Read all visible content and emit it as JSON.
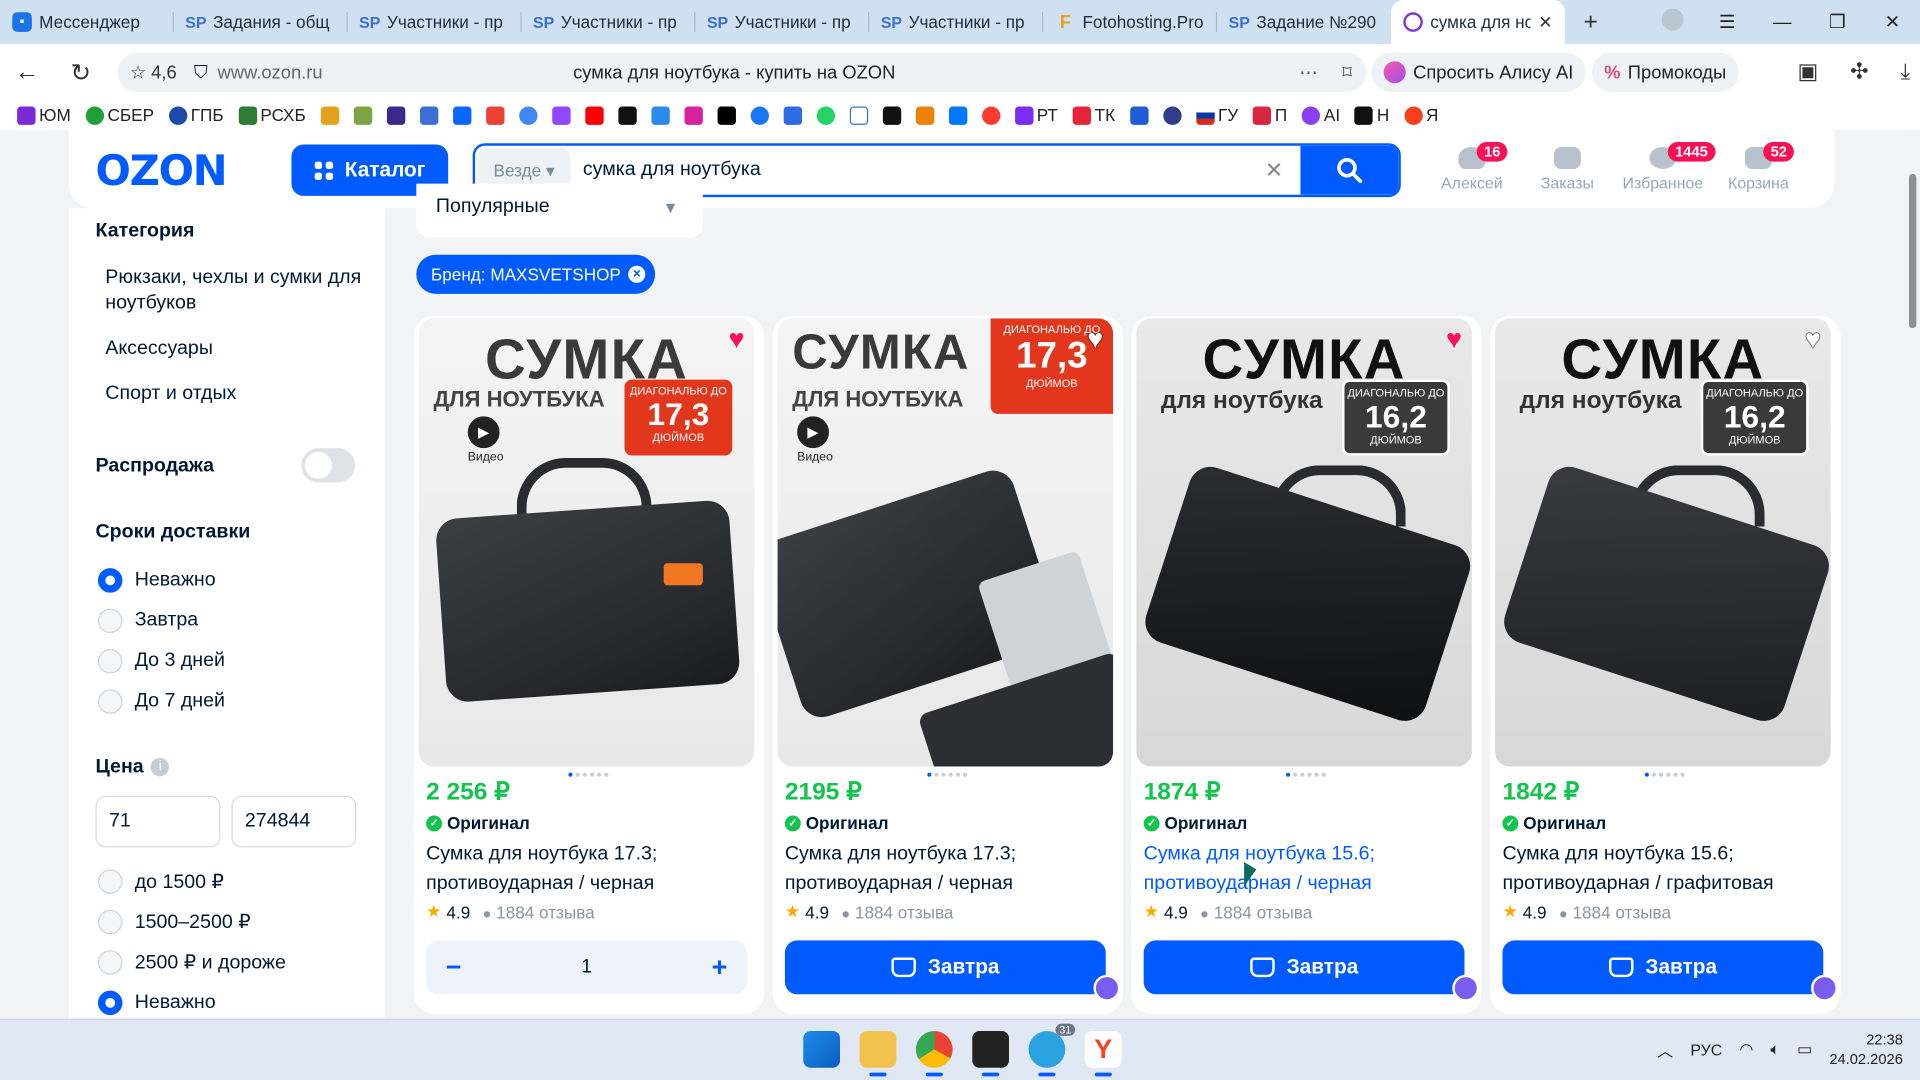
{
  "browser": {
    "tabs": [
      {
        "label": "Мессенджер",
        "icon": "messenger-icon"
      },
      {
        "label": "Задания - общ",
        "icon": "sp-icon"
      },
      {
        "label": "Участники - пр",
        "icon": "sp-icon"
      },
      {
        "label": "Участники - пр",
        "icon": "sp-icon"
      },
      {
        "label": "Участники - пр",
        "icon": "sp-icon"
      },
      {
        "label": "Участники - пр",
        "icon": "sp-icon"
      },
      {
        "label": "Fotohosting.Pro",
        "icon": "fotohosting-icon"
      },
      {
        "label": "Задание №290",
        "icon": "sp-icon"
      },
      {
        "label": "сумка для но",
        "icon": "ozon-icon",
        "active": true
      }
    ],
    "url_rating": "4,6",
    "url_host": "www.ozon.ru",
    "page_title": "сумка для ноутбука - купить на OZON",
    "alice_label": "Спросить Алису AI",
    "promo_label": "Промокоды",
    "bookmarks": [
      "ЮМ",
      "СБЕР",
      "ГПБ",
      "РСХБ",
      "РТ",
      "ТК",
      "ГУ",
      "П",
      "AI",
      "Н",
      "Я"
    ]
  },
  "header": {
    "logo": "OZON",
    "catalog_label": "Каталог",
    "search_scope": "Везде",
    "search_value": "сумка для ноутбука",
    "profile": {
      "label": "Алексей",
      "badge": "16"
    },
    "orders": {
      "label": "Заказы"
    },
    "favorites": {
      "label": "Избранное",
      "badge": "1445"
    },
    "cart": {
      "label": "Корзина",
      "badge": "52"
    }
  },
  "sidebar": {
    "category_title": "Категория",
    "categories": [
      "Рюкзаки, чехлы и сумки для ноутбуков",
      "Аксессуары",
      "Спорт и отдых"
    ],
    "sale_label": "Распродажа",
    "delivery_title": "Сроки доставки",
    "delivery_options": [
      "Неважно",
      "Завтра",
      "До 3 дней",
      "До 7 дней"
    ],
    "price_title": "Цена",
    "price_min": "71",
    "price_max": "274844",
    "price_options": [
      "до 1500 ₽",
      "1500–2500 ₽",
      "2500 ₽ и дороже",
      "Неважно"
    ]
  },
  "main": {
    "sort_value": "Популярные",
    "brand_chip": "Бренд: MAXSVETSHOP",
    "products": [
      {
        "price": "2 256 ₽",
        "badge": "Оригинал",
        "name": "Сумка для ноутбука 17.3; противоударная / черная",
        "rating": "4.9",
        "reviews": "1884 отзыва",
        "favorite": true,
        "img_title": "СУМКА",
        "img_sub": "ДЛЯ НОУТБУКА",
        "diag_top": "ДИАГОНАЛЬЮ ДО",
        "diag_value": "17,3",
        "diag_unit": "ДЮЙМОВ",
        "video": "Видео",
        "quantity": "1"
      },
      {
        "price": "2195 ₽",
        "badge": "Оригинал",
        "name": "Сумка для ноутбука 17.3; противоударная / черная",
        "rating": "4.9",
        "reviews": "1884 отзыва",
        "favorite": false,
        "img_title": "СУМКА",
        "img_sub": "ДЛЯ НОУТБУКА",
        "diag_top": "ДИАГОНАЛЬЮ ДО",
        "diag_value": "17,3",
        "diag_unit": "ДЮЙМОВ",
        "video": "Видео",
        "button": "Завтра"
      },
      {
        "price": "1874 ₽",
        "badge": "Оригинал",
        "name": "Сумка для ноутбука 15.6; противоударная / черная",
        "rating": "4.9",
        "reviews": "1884 отзыва",
        "favorite": true,
        "img_title": "СУМКА",
        "img_sub": "для ноутбука",
        "diag_top": "ДИАГОНАЛЬЮ ДО",
        "diag_value": "16,2",
        "diag_unit": "ДЮЙМОВ",
        "button": "Завтра"
      },
      {
        "price": "1842 ₽",
        "badge": "Оригинал",
        "name": "Сумка для ноутбука 15.6; противоударная / графитовая",
        "rating": "4.9",
        "reviews": "1884 отзыва",
        "favorite": false,
        "img_title": "СУМКА",
        "img_sub": "для ноутбука",
        "diag_top": "ДИАГОНАЛЬЮ ДО",
        "diag_value": "16,2",
        "diag_unit": "ДЮЙМОВ",
        "button": "Завтра"
      }
    ]
  },
  "taskbar": {
    "lang": "РУС",
    "time": "22:38",
    "date": "24.02.2026",
    "telegram_badge": "31"
  },
  "colors": {
    "brand": "#005bff",
    "price": "#10c44c",
    "badge": "#f91155"
  }
}
